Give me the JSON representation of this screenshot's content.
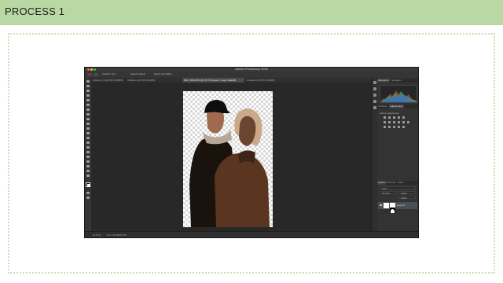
{
  "header": {
    "title": "PROCESS 1"
  },
  "photoshop": {
    "app_title": "Adobe Photoshop 2020",
    "options": [
      "Feather: 0 px",
      "Select Subject",
      "Select and Mask..."
    ],
    "doc_tabs": [
      {
        "label": "fullbody 1.tif @ 50% (RGB/8)",
        "active": false
      },
      {
        "label": "Untitled-1 @ 50% (RGB/8)",
        "active": false
      },
      {
        "label": "IMG_0003.JPG @ 16.7% (Layer 0, Layer Mask/8)",
        "active": true
      },
      {
        "label": "Untitled-2 @ 50% (RGB/8)",
        "active": false
      }
    ],
    "status": {
      "zoom": "16.67%",
      "doc_size": "Doc: 34.3M/45.7M"
    },
    "panels": {
      "top_tabs": [
        "Histogram",
        "Navigator"
      ],
      "mid_tabs": [
        "Libraries",
        "Adjustments"
      ],
      "adjust_subtitle": "Add an adjustment",
      "layers_tabs": [
        "Layers",
        "Channels",
        "Paths"
      ],
      "kind_label": "Kind",
      "blend_mode": "Normal",
      "opacity": "100%",
      "fill": "100%",
      "layer_name": "Layer 0"
    },
    "colors": {
      "accent": "#b9d8a4",
      "ui_dark": "#2b2b2b",
      "selected_layer": "#4a4f57"
    }
  }
}
